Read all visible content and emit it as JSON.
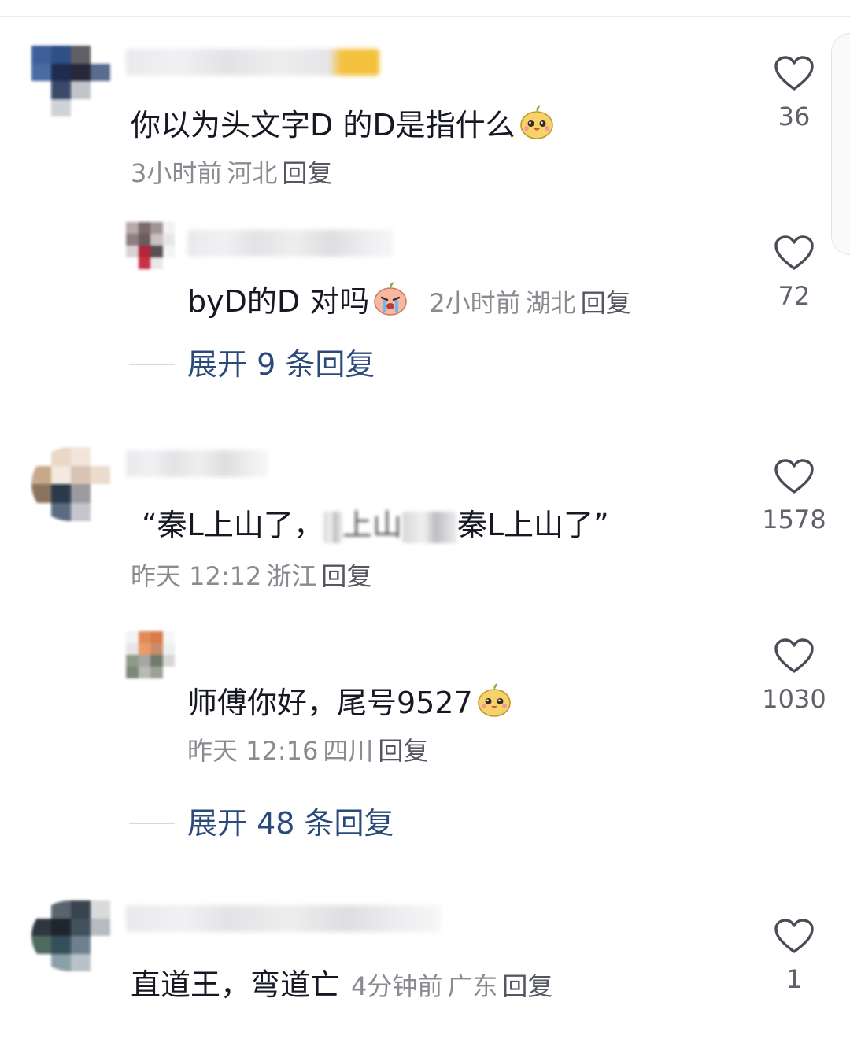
{
  "comments": [
    {
      "text": "你以为头文字D  的D是指什么",
      "meta": {
        "time": "3小时前",
        "location": "河北",
        "reply_label": "回复"
      },
      "likes": "36",
      "emoji": "pear-smile-emoji",
      "replies": [
        {
          "text": "byD的D 对吗",
          "meta": {
            "time": "2小时前",
            "location": "湖北",
            "reply_label": "回复"
          },
          "likes": "72",
          "emoji": "crying-pear-emoji"
        }
      ],
      "expand_label": "展开 9 条回复"
    },
    {
      "text_part1": "“秦L上山了，",
      "text_part2": "上山",
      "text_part3": "秦L上山了”",
      "meta": {
        "time": "昨天 12:12",
        "location": "浙江",
        "reply_label": "回复"
      },
      "likes": "1578",
      "replies": [
        {
          "text": "师傅你好，尾号9527",
          "meta": {
            "time": "昨天 12:16",
            "location": "四川",
            "reply_label": "回复"
          },
          "likes": "1030",
          "emoji": "pear-smile-emoji"
        }
      ],
      "expand_label": "展开 48 条回复"
    },
    {
      "text": "直道王，弯道亡",
      "meta": {
        "time": "4分钟前",
        "location": "广东",
        "reply_label": "回复"
      },
      "likes": "1"
    }
  ],
  "icons": {
    "like": "heart-outline-icon"
  },
  "colors": {
    "text": "#161823",
    "meta": "#8a8b91",
    "expand": "#2a4a7a",
    "like_stroke": "#4a4c55"
  }
}
